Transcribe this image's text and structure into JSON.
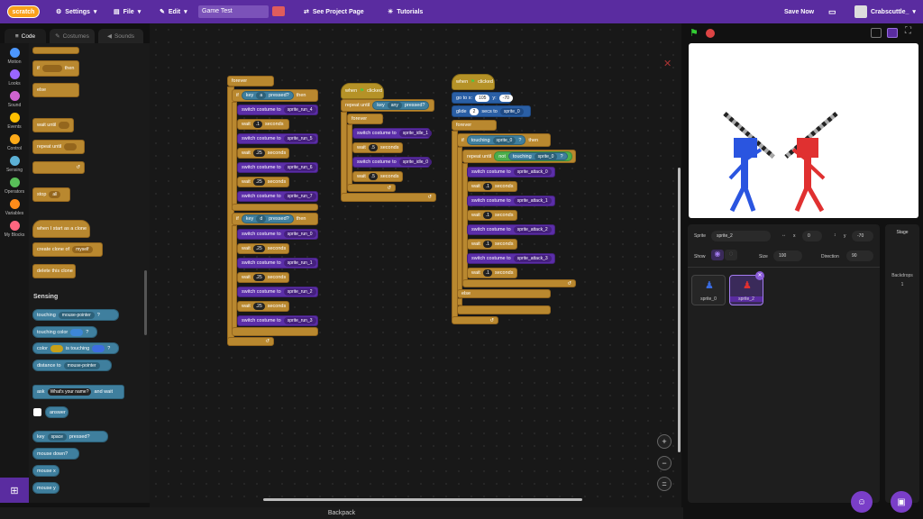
{
  "header": {
    "logo": "scratch",
    "settings": "Settings",
    "file": "File",
    "edit": "Edit",
    "project_title": "Game Test",
    "see_project": "See Project Page",
    "tutorials": "Tutorials",
    "save_now": "Save Now",
    "username": "Crabscuttle_"
  },
  "tabs": {
    "code": "Code",
    "costumes": "Costumes",
    "sounds": "Sounds"
  },
  "categories": [
    {
      "label": "Motion",
      "color": "#4c97ff"
    },
    {
      "label": "Looks",
      "color": "#9966ff"
    },
    {
      "label": "Sound",
      "color": "#cf63cf"
    },
    {
      "label": "Events",
      "color": "#ffbf00"
    },
    {
      "label": "Control",
      "color": "#ffab19"
    },
    {
      "label": "Sensing",
      "color": "#5cb1d6"
    },
    {
      "label": "Operators",
      "color": "#59c059"
    },
    {
      "label": "Variables",
      "color": "#ff8c1a"
    },
    {
      "label": "My Blocks",
      "color": "#ff6680"
    }
  ],
  "palette": {
    "if": "if",
    "then": "then",
    "else": "else",
    "wait_until": "wait until",
    "repeat_until": "repeat until",
    "stop": "stop",
    "stop_val": "all",
    "when_clone": "when I start as a clone",
    "create_clone": "create clone of",
    "myself": "myself",
    "delete_clone": "delete this clone",
    "sensing_header": "Sensing",
    "touching": "touching",
    "mouse_pointer": "mouse-pointer",
    "q": "?",
    "touching_color": "touching color",
    "color": "color",
    "is_touching": "is touching",
    "distance_to": "distance to",
    "ask": "ask",
    "ask_default": "What's your name?",
    "and_wait": "and wait",
    "answer": "answer",
    "key": "key",
    "space": "space",
    "pressed": "pressed?",
    "mouse_down": "mouse down?",
    "mouse_x": "mouse x",
    "mouse_y": "mouse y"
  },
  "script1": {
    "forever": "forever",
    "if": "if",
    "key": "key",
    "key_a": "a",
    "pressed": "pressed?",
    "then": "then",
    "switch": "switch costume to",
    "wait": "wait",
    "seconds": "seconds",
    "key_d": "d",
    "run4": "sprite_run_4",
    "run5": "sprite_run_5",
    "run6": "sprite_run_6",
    "run7": "sprite_run_7",
    "run0": "sprite_run_0",
    "run1": "sprite_run_1",
    "run2": "sprite_run_2",
    "run3": "sprite_run_3",
    "w1": ".1",
    "w25": ".25"
  },
  "script2": {
    "when": "when",
    "clicked": "clicked",
    "repeat_until": "repeat until",
    "key": "key",
    "any": "any",
    "pressed": "pressed?",
    "forever": "forever",
    "switch": "switch costume to",
    "idle1": "sprite_idle_1",
    "idle0": "sprite_idle_0",
    "wait": "wait",
    "seconds": "seconds",
    "w": ".5"
  },
  "script3": {
    "when": "when",
    "clicked": "clicked",
    "goto": "go to x:",
    "x": "105",
    "y_lbl": "y:",
    "y": "-70",
    "glide": "glide",
    "g": "2",
    "secs_to": "secs to",
    "target": "sprite_0",
    "forever": "forever",
    "if": "if",
    "touching": "touching",
    "then": "then",
    "q": "?",
    "repeat_until": "repeat until",
    "not": "not",
    "switch": "switch costume to",
    "a0": "sprite_attack_0",
    "a1": "sprite_attack_1",
    "a2": "sprite_attack_2",
    "a3": "sprite_attack_3",
    "wait": "wait",
    "seconds": "seconds",
    "w": ".1",
    "else": "else"
  },
  "sprite_info": {
    "sprite_lbl": "Sprite",
    "sprite_name": "sprite_2",
    "x_lbl": "x",
    "x": "0",
    "y_lbl": "y",
    "y": "-70",
    "show_lbl": "Show",
    "size_lbl": "Size",
    "size": "100",
    "dir_lbl": "Direction",
    "dir": "90"
  },
  "sprites": [
    {
      "name": "sprite_0"
    },
    {
      "name": "sprite_2"
    }
  ],
  "stage_col": {
    "stage": "Stage",
    "backdrops": "Backdrops",
    "count": "1"
  },
  "backpack": "Backpack",
  "zoom": {
    "in": "+",
    "out": "−",
    "reset": "="
  }
}
